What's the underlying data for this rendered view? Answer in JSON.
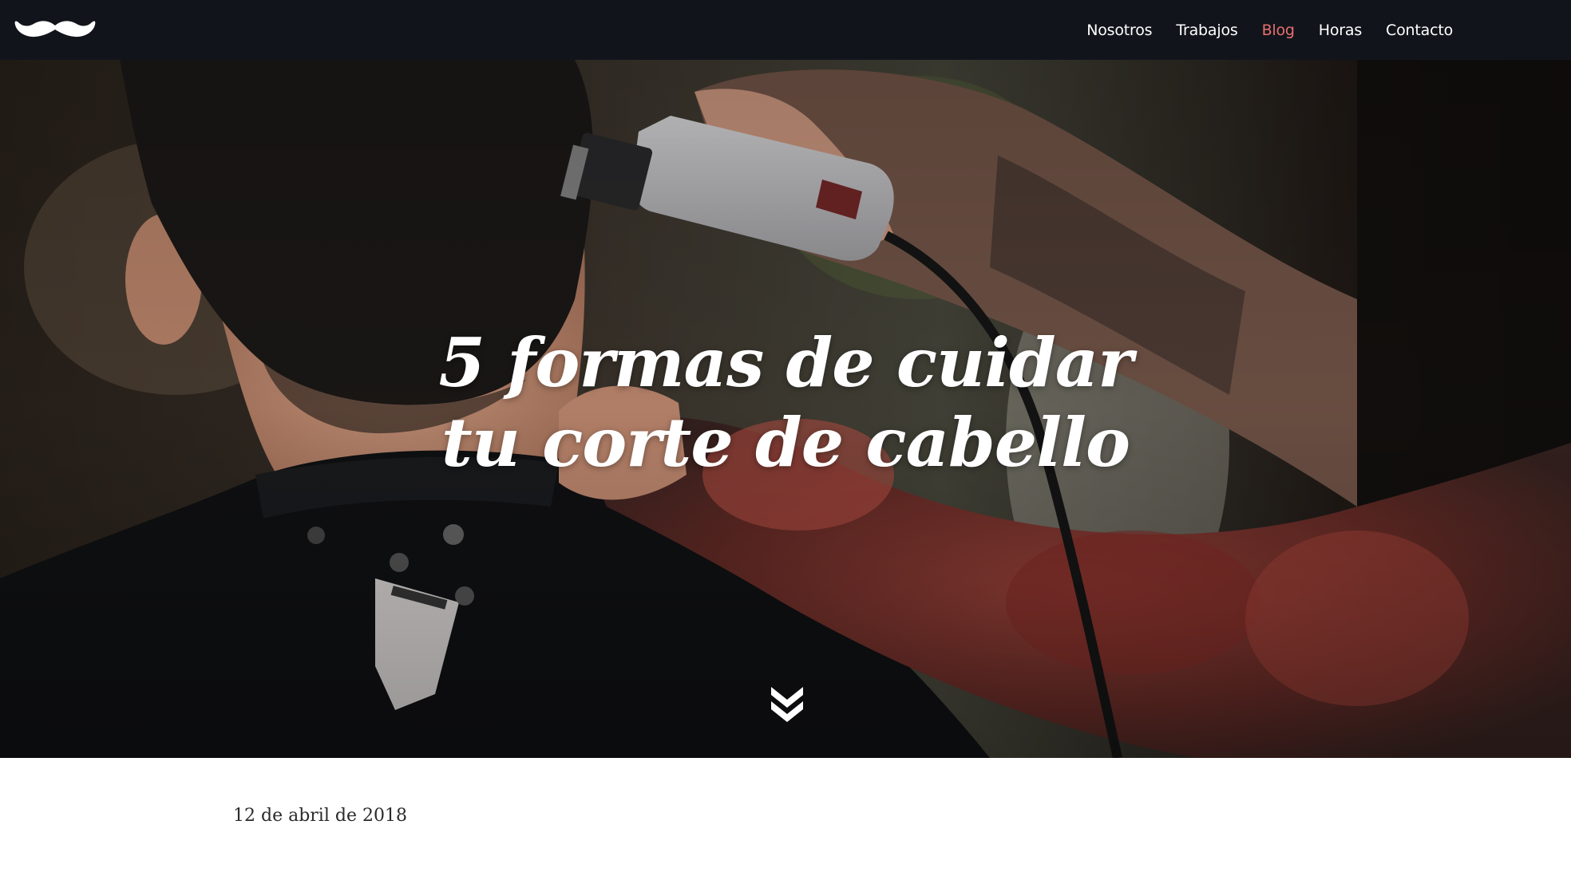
{
  "header": {
    "logo_icon": "mustache-icon",
    "nav": [
      {
        "label": "Nosotros",
        "active": false
      },
      {
        "label": "Trabajos",
        "active": false
      },
      {
        "label": "Blog",
        "active": true
      },
      {
        "label": "Horas",
        "active": false
      },
      {
        "label": "Contacto",
        "active": false
      }
    ]
  },
  "hero": {
    "title_line1": "5 formas de cuidar",
    "title_line2": "tu corte de cabello",
    "scroll_icon": "double-chevron-down-icon"
  },
  "post": {
    "date": "12 de abril de 2018"
  },
  "colors": {
    "nav_bg": "#11151b",
    "nav_text": "#ffffff",
    "nav_active": "#e76f6f"
  }
}
